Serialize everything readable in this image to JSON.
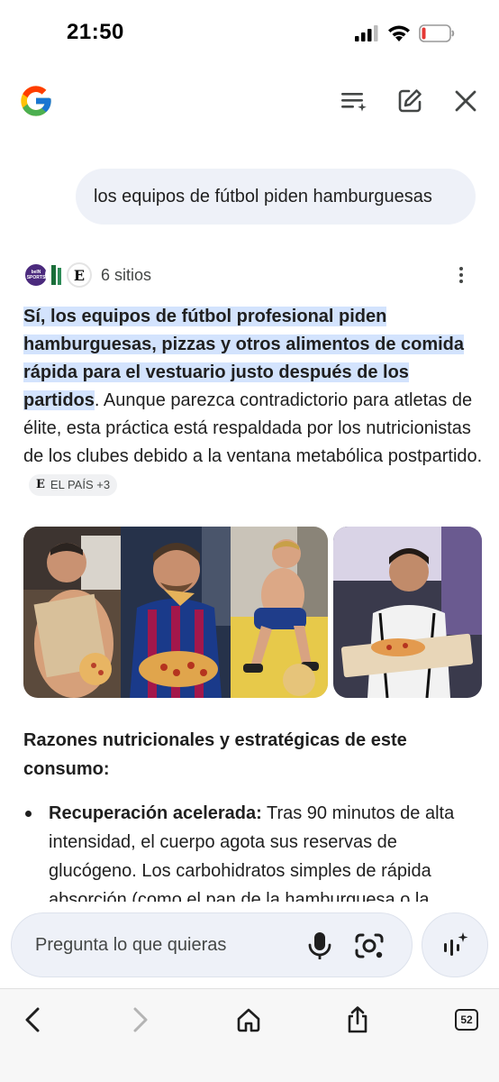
{
  "status_bar": {
    "time": "21:50"
  },
  "header": {
    "logo_icon": "google-g-icon",
    "actions": [
      {
        "name": "playlist-add-icon"
      },
      {
        "name": "edit-icon"
      },
      {
        "name": "close-icon"
      }
    ]
  },
  "query": {
    "text": "los equipos de fútbol piden hamburguesas"
  },
  "sources": {
    "bein_label": "beIN SPORTS",
    "elpais_letter": "E",
    "count_label": "6 sitios"
  },
  "answer": {
    "highlight_1": "Sí, los equipos de fútbol profesional piden",
    "highlight_2": "hamburguesas, pizzas y otros alimentos de comida",
    "highlight_3": "rápida para el vestuario justo después de los",
    "highlight_4": "partidos",
    "body": ". Aunque parezca contradictorio para atletas de élite, esta práctica está respaldada por los nutricionistas de los clubes debido a la ventana metabólica postpartido.",
    "citation_letter": "E",
    "citation_label": "EL PAÍS +3"
  },
  "images": [
    {
      "name": "player-eating-pizza-1"
    },
    {
      "name": "player-eating-pizza-2"
    },
    {
      "name": "player-eating-pizza-3"
    },
    {
      "name": "player-eating-pizza-4"
    }
  ],
  "section": {
    "title": "Razones nutricionales y estratégicas de este consumo:",
    "bullets": [
      {
        "bold": "Recuperación acelerada:",
        "text": " Tras 90 minutos de alta intensidad, el cuerpo agota sus reservas de glucógeno. Los carbohidratos simples de rápida absorción (como el pan de la hamburguesa o la"
      }
    ]
  },
  "input": {
    "placeholder": "Pregunta lo que quieras"
  },
  "toolbar": {
    "tabs_count": "52"
  },
  "colors": {
    "highlight": "#d3e3fd",
    "field_bg": "#eef1f8",
    "text": "#1f1f1f"
  }
}
